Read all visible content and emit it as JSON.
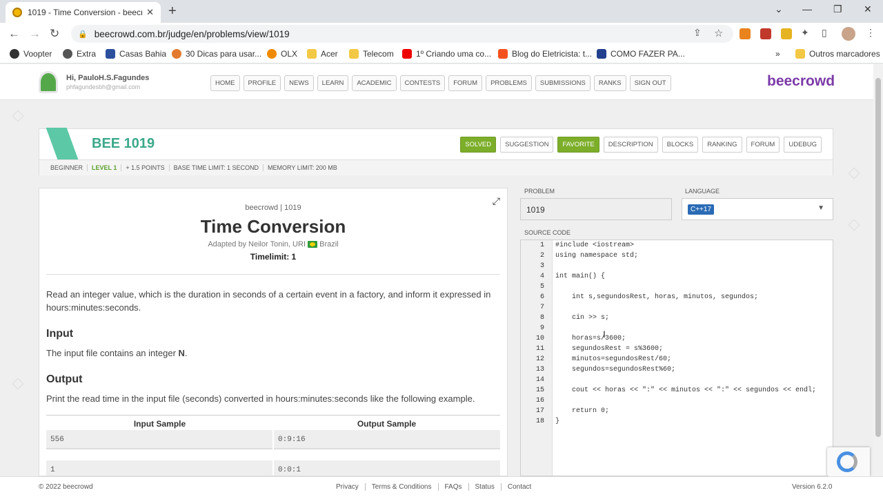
{
  "browser": {
    "tab_title": "1019 - Time Conversion - beecro",
    "url": "beecrowd.com.br/judge/en/problems/view/1019",
    "bookmarks": [
      "Voopter",
      "Extra",
      "Casas Bahia",
      "30 Dicas para usar...",
      "OLX",
      "Acer",
      "Telecom",
      "1º Criando uma co...",
      "Blog do Eletricista: t...",
      "COMO FAZER PA..."
    ],
    "other_bookmarks": "Outros marcadores"
  },
  "site": {
    "greeting": "Hi, PauloH.S.Fagundes",
    "email": "phfagundesbh@gmail.com",
    "nav": [
      "HOME",
      "PROFILE",
      "NEWS",
      "LEARN",
      "ACADEMIC",
      "CONTESTS",
      "FORUM",
      "PROBLEMS",
      "SUBMISSIONS",
      "RANKS",
      "SIGN OUT"
    ],
    "brand": "beecrowd"
  },
  "problem": {
    "id_label": "BEE 1019",
    "buttons": [
      "SOLVED",
      "SUGGESTION",
      "FAVORITE",
      "DESCRIPTION",
      "BLOCKS",
      "RANKING",
      "FORUM",
      "UDEBUG"
    ],
    "info": [
      "BEGINNER",
      "LEVEL 1",
      "+ 1.5 POINTS",
      "BASE TIME LIMIT: 1 SECOND",
      "MEMORY LIMIT: 200 MB"
    ],
    "crumb": "beecrowd | 1019",
    "title": "Time Conversion",
    "adapted": "Adapted by Neilor Tonin, URI",
    "country": "Brazil",
    "timelimit": "Timelimit: 1",
    "statement": "Read an integer value, which is the duration in seconds of a certain event in a factory, and inform it expressed in hours:minutes:seconds.",
    "input_heading": "Input",
    "input_text": "The input file contains an integer",
    "input_var": "N",
    "output_heading": "Output",
    "output_text": "Print the read time in the input file (seconds) converted in hours:minutes:seconds like the following example.",
    "sample_headers": [
      "Input Sample",
      "Output Sample"
    ],
    "samples": [
      [
        "556",
        "0:9:16"
      ],
      [
        "1",
        "0:0:1"
      ]
    ]
  },
  "editor": {
    "problem_label": "PROBLEM",
    "problem_value": "1019",
    "language_label": "LANGUAGE",
    "language_value": "C++17",
    "source_label": "SOURCE CODE",
    "lines": [
      "#include <iostream>",
      "using namespace std;",
      "",
      "int main() {",
      "",
      "    int s,segundosRest, horas, minutos, segundos;",
      "",
      "    cin >> s;",
      "",
      "    horas=s/3600;",
      "    segundosRest = s%3600;",
      "    minutos=segundosRest/60;",
      "    segundos=segundosRest%60;",
      "",
      "    cout << horas << \":\" << minutos << \":\" << segundos << endl;",
      "",
      "    return 0;",
      "}"
    ]
  },
  "footer": {
    "copyright": "© 2022 beecrowd",
    "links": [
      "Privacy",
      "Terms & Conditions",
      "FAQs",
      "Status",
      "Contact"
    ],
    "version": "Version 6.2.0"
  }
}
